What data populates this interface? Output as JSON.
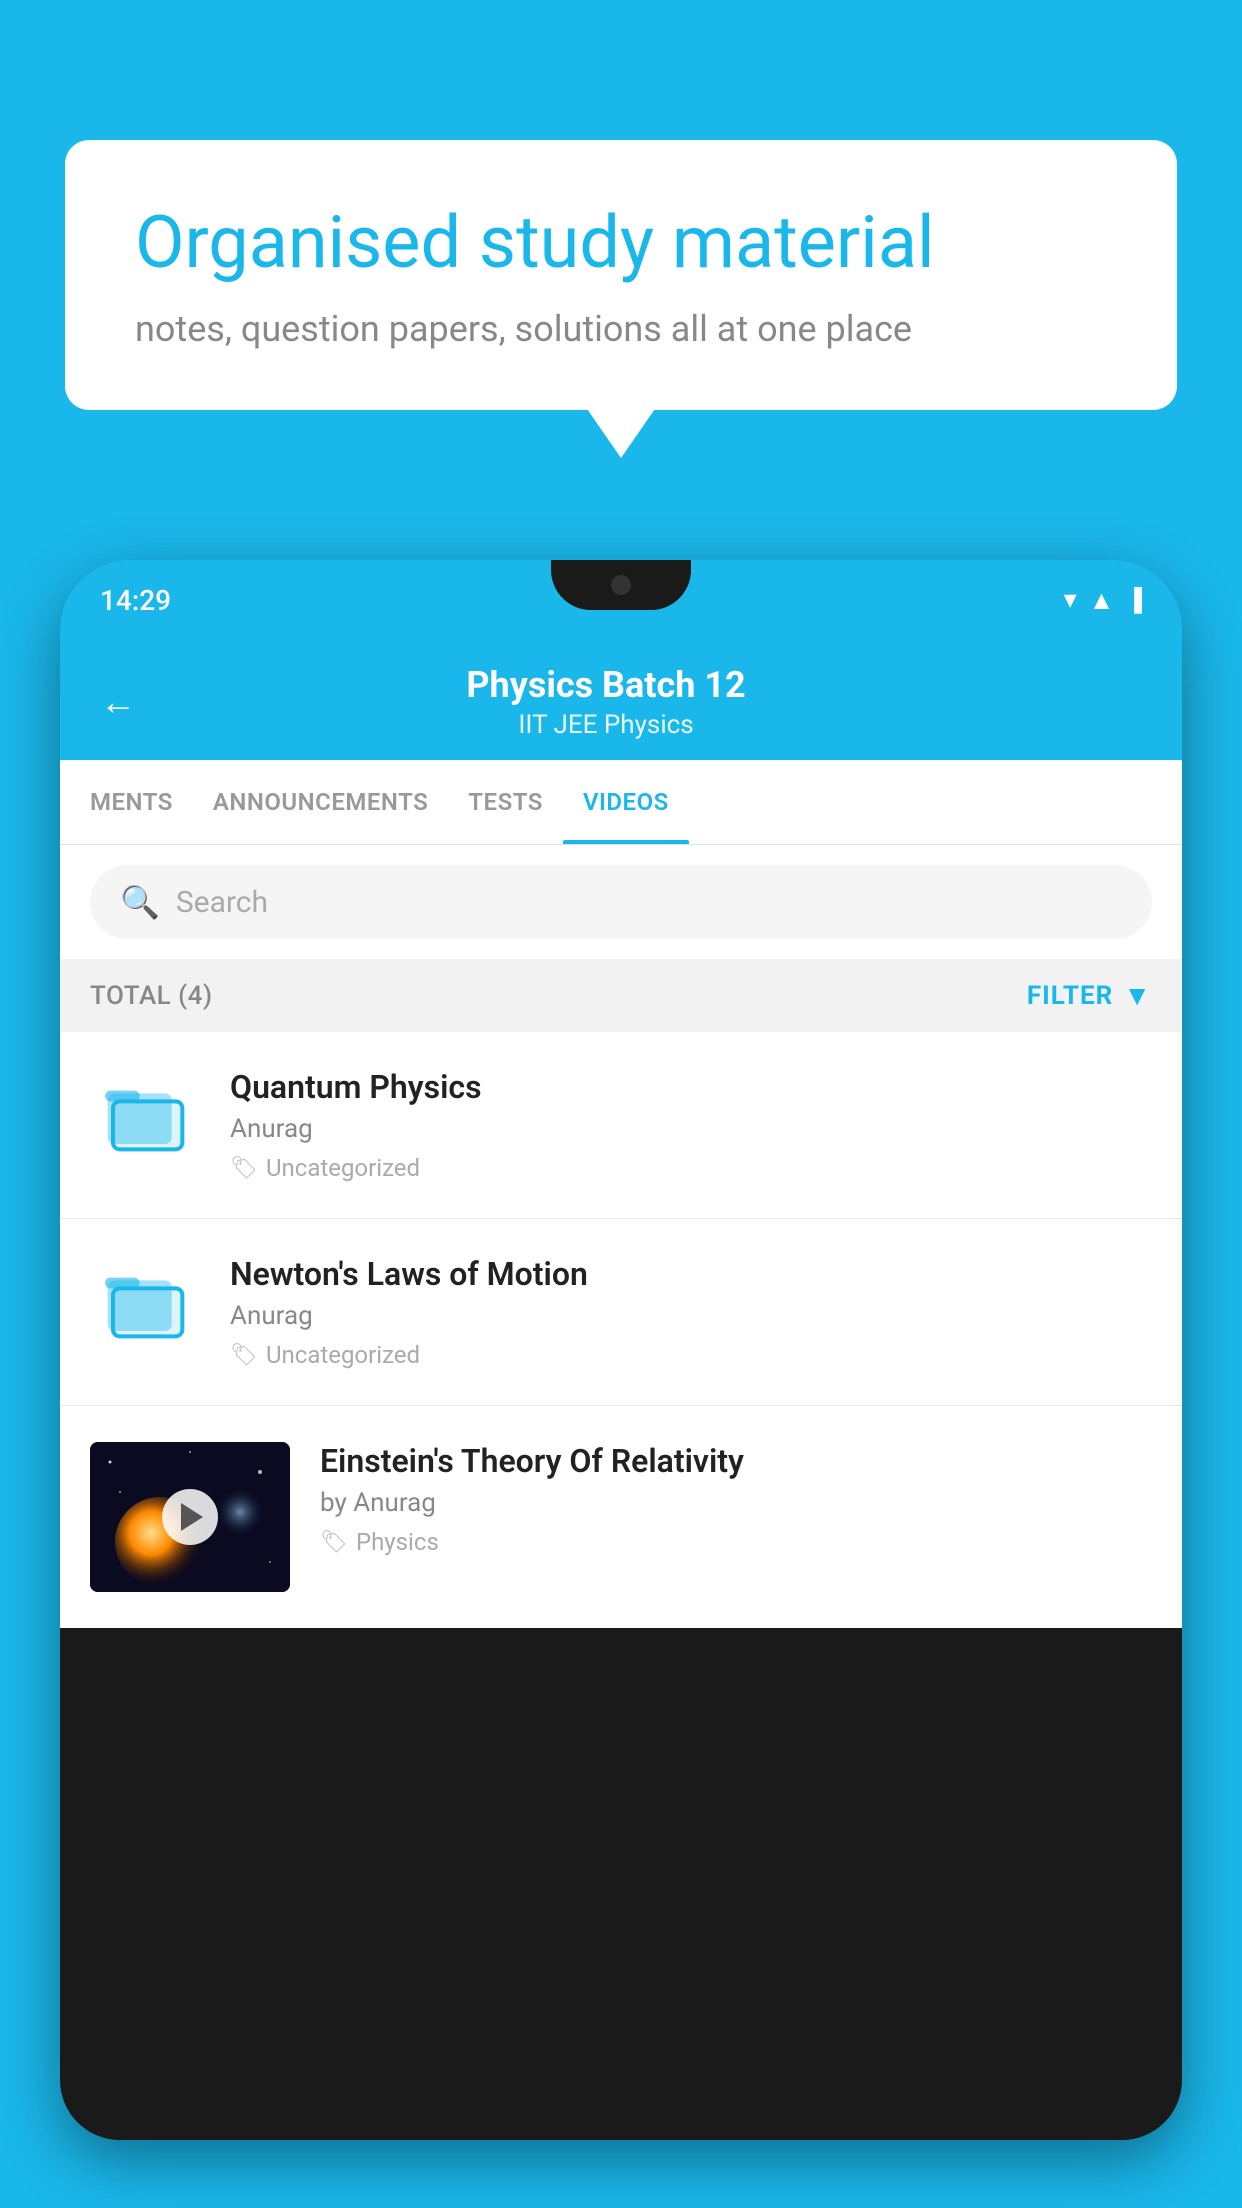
{
  "background_color": "#1ab7ea",
  "bubble": {
    "title": "Organised study material",
    "subtitle": "notes, question papers, solutions all at one place"
  },
  "phone": {
    "status_time": "14:29",
    "header": {
      "title": "Physics Batch 12",
      "subtitle": "IIT JEE   Physics",
      "back_label": "←"
    },
    "tabs": [
      {
        "label": "MENTS",
        "active": false
      },
      {
        "label": "ANNOUNCEMENTS",
        "active": false
      },
      {
        "label": "TESTS",
        "active": false
      },
      {
        "label": "VIDEOS",
        "active": true
      }
    ],
    "search": {
      "placeholder": "Search"
    },
    "filter": {
      "total_label": "TOTAL (4)",
      "filter_label": "FILTER"
    },
    "videos": [
      {
        "title": "Quantum Physics",
        "author": "Anurag",
        "tag": "Uncategorized",
        "has_thumbnail": false
      },
      {
        "title": "Newton's Laws of Motion",
        "author": "Anurag",
        "tag": "Uncategorized",
        "has_thumbnail": false
      },
      {
        "title": "Einstein's Theory Of Relativity",
        "author": "by Anurag",
        "tag": "Physics",
        "has_thumbnail": true
      }
    ]
  }
}
